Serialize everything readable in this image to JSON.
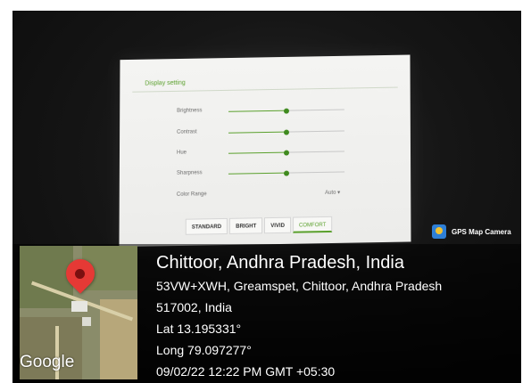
{
  "display_settings": {
    "title": "Display setting",
    "rows": [
      {
        "label": "Brightness",
        "level": 0.5
      },
      {
        "label": "Contrast",
        "level": 0.5
      },
      {
        "label": "Hue",
        "level": 0.5
      },
      {
        "label": "Sharpness",
        "level": 0.5
      }
    ],
    "color_range": {
      "label": "Color Range",
      "value": "Auto"
    },
    "modes": [
      "STANDARD",
      "BRIGHT",
      "VIVID",
      "COMFORT"
    ],
    "active_mode": "COMFORT",
    "accent_color": "#5aa02c"
  },
  "gps_badge": {
    "label": "GPS Map Camera"
  },
  "map": {
    "logo": "Google",
    "pin_color": "#e53935"
  },
  "location": {
    "title": "Chittoor, Andhra Pradesh, India",
    "address_line1": "53VW+XWH, Greamspet, Chittoor, Andhra Pradesh",
    "address_line2": "517002, India",
    "lat": "Lat 13.195331°",
    "long": "Long 79.097277°",
    "datetime": "09/02/22 12:22 PM GMT +05:30"
  }
}
